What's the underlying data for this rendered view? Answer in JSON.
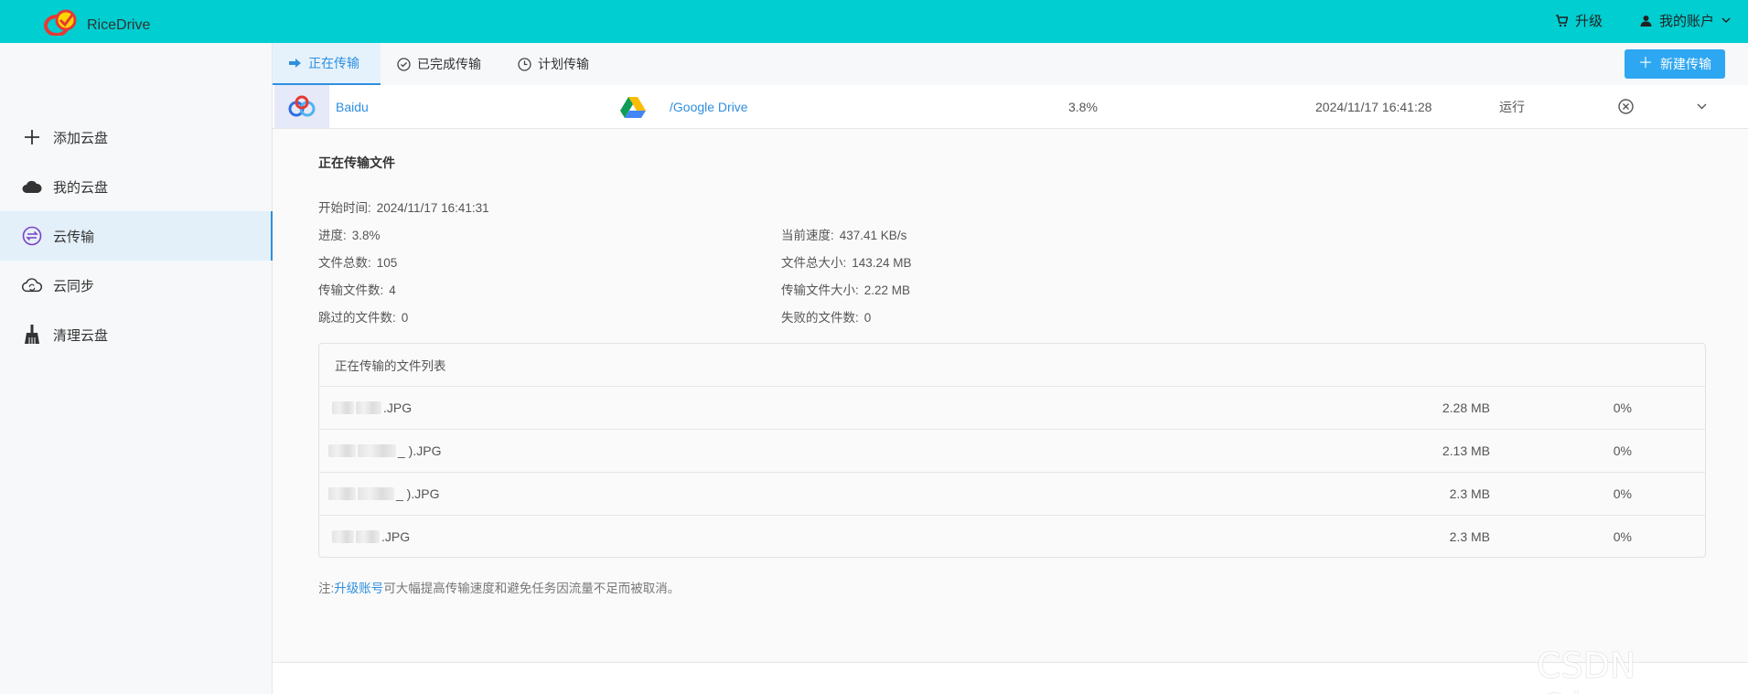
{
  "header": {
    "brand": "RiceDrive",
    "upgrade_label": "升级",
    "account_label": "我的账户"
  },
  "sidebar": {
    "items": [
      {
        "label": "添加云盘",
        "icon": "plus-icon"
      },
      {
        "label": "我的云盘",
        "icon": "cloud-icon"
      },
      {
        "label": "云传输",
        "icon": "transfer-icon",
        "active": true
      },
      {
        "label": "云同步",
        "icon": "cloud-sync-icon"
      },
      {
        "label": "清理云盘",
        "icon": "broom-icon"
      }
    ]
  },
  "tabs": [
    {
      "label": "正在传输",
      "icon": "arrow-right-icon",
      "active": true
    },
    {
      "label": "已完成传输",
      "icon": "check-circle-icon"
    },
    {
      "label": "计划传输",
      "icon": "clock-icon"
    }
  ],
  "new_transfer_label": "新建传输",
  "task": {
    "source": "Baidu",
    "destination": "/Google Drive",
    "progress": "3.8%",
    "start_time": "2024/11/17 16:41:28",
    "status": "运行"
  },
  "detail": {
    "title": "正在传输文件",
    "start_time_label": "开始时间:",
    "start_time": "2024/11/17 16:41:31",
    "progress_label": "进度:",
    "progress": "3.8%",
    "speed_label": "当前速度:",
    "speed": "437.41 KB/s",
    "total_files_label": "文件总数:",
    "total_files": "105",
    "total_size_label": "文件总大小:",
    "total_size": "143.24 MB",
    "transferred_files_label": "传输文件数:",
    "transferred_files": "4",
    "transferred_size_label": "传输文件大小:",
    "transferred_size": "2.22 MB",
    "skipped_label": "跳过的文件数:",
    "skipped": "0",
    "failed_label": "失败的文件数:",
    "failed": "0"
  },
  "file_list": {
    "title": "正在传输的文件列表",
    "rows": [
      {
        "name": ".JPG",
        "size": "2.28 MB",
        "pct": "0%"
      },
      {
        "name": "_ ).JPG",
        "size": "2.13 MB",
        "pct": "0%"
      },
      {
        "name": "_ ).JPG",
        "size": "2.3 MB",
        "pct": "0%"
      },
      {
        "name": ".JPG",
        "size": "2.3 MB",
        "pct": "0%"
      }
    ]
  },
  "note": {
    "prefix": "注:",
    "link": "升级账号",
    "suffix": "可大幅提高传输速度和避免任务因流量不足而被取消。"
  },
  "watermark": "CSDN @bgom",
  "colors": {
    "topbar": "#00ced1",
    "accent": "#2f8fdf",
    "button": "#2ea7f2"
  }
}
